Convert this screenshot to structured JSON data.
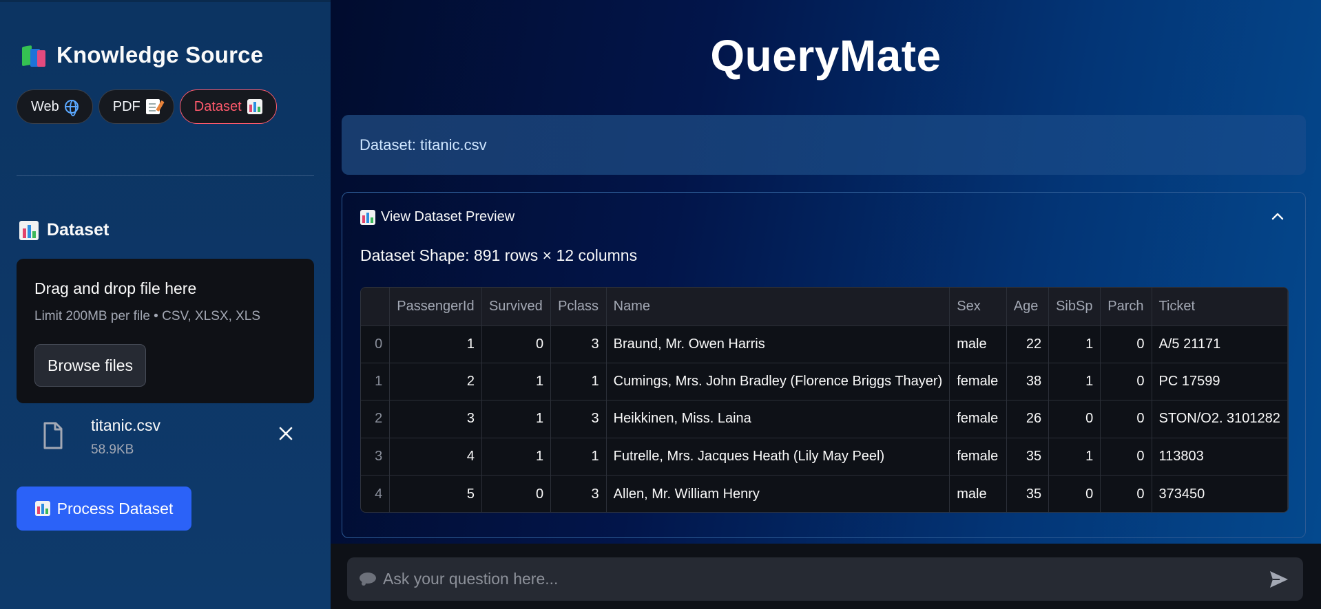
{
  "sidebar": {
    "title": "Knowledge Source",
    "title_icon": "books-icon",
    "sources": [
      {
        "label": "Web",
        "icon": "globe-icon",
        "active": false
      },
      {
        "label": "PDF",
        "icon": "memo-icon",
        "active": false
      },
      {
        "label": "Dataset",
        "icon": "bar-chart-icon",
        "active": true
      }
    ],
    "section_title": "Dataset",
    "uploader": {
      "title": "Drag and drop file here",
      "limit": "Limit 200MB per file • CSV, XLSX, XLS",
      "browse_label": "Browse files"
    },
    "file": {
      "name": "titanic.csv",
      "size": "58.9KB"
    },
    "process_label": "Process Dataset",
    "accent_color": "#2b62f8",
    "active_color": "#ff5a6c"
  },
  "main": {
    "title": "QueryMate",
    "info": "Dataset: titanic.csv",
    "expander": {
      "label": "View Dataset Preview",
      "expanded": true,
      "shape": "Dataset Shape: 891 rows × 12 columns"
    },
    "table": {
      "columns": [
        "",
        "PassengerId",
        "Survived",
        "Pclass",
        "Name",
        "Sex",
        "Age",
        "SibSp",
        "Parch",
        "Ticket"
      ],
      "rows": [
        [
          "0",
          "1",
          "0",
          "3",
          "Braund, Mr. Owen Harris",
          "male",
          "22",
          "1",
          "0",
          "A/5 21171"
        ],
        [
          "1",
          "2",
          "1",
          "1",
          "Cumings, Mrs. John Bradley (Florence Briggs Thayer)",
          "female",
          "38",
          "1",
          "0",
          "PC 17599"
        ],
        [
          "2",
          "3",
          "1",
          "3",
          "Heikkinen, Miss. Laina",
          "female",
          "26",
          "0",
          "0",
          "STON/O2. 3101282"
        ],
        [
          "3",
          "4",
          "1",
          "1",
          "Futrelle, Mrs. Jacques Heath (Lily May Peel)",
          "female",
          "35",
          "1",
          "0",
          "113803"
        ],
        [
          "4",
          "5",
          "0",
          "3",
          "Allen, Mr. William Henry",
          "male",
          "35",
          "0",
          "0",
          "373450"
        ]
      ]
    },
    "chat": {
      "placeholder": "Ask your question here..."
    }
  }
}
